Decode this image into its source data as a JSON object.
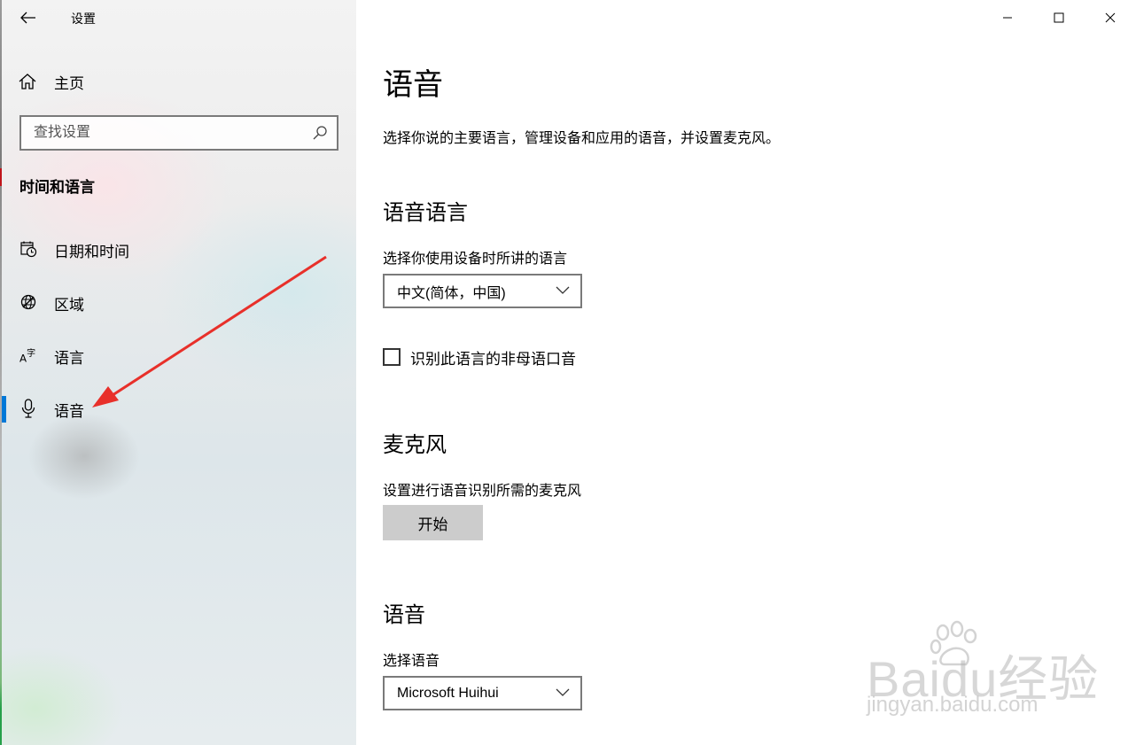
{
  "window": {
    "title": "设置",
    "controls": [
      "minimize",
      "maximize",
      "close"
    ]
  },
  "sidebar": {
    "home_label": "主页",
    "search_placeholder": "查找设置",
    "section_header": "时间和语言",
    "items": [
      {
        "label": "日期和时间",
        "icon": "calendar-clock-icon",
        "active": false
      },
      {
        "label": "区域",
        "icon": "globe-icon",
        "active": false
      },
      {
        "label": "语言",
        "icon": "language-icon",
        "active": false
      },
      {
        "label": "语音",
        "icon": "microphone-icon",
        "active": true
      }
    ]
  },
  "main": {
    "title": "语音",
    "description": "选择你说的主要语言，管理设备和应用的语音，并设置麦克风。",
    "speech_language": {
      "heading": "语音语言",
      "label": "选择你使用设备时所讲的语言",
      "selected": "中文(简体，中国)",
      "checkbox_label": "识别此语言的非母语口音",
      "checkbox_checked": false
    },
    "microphone": {
      "heading": "麦克风",
      "label": "设置进行语音识别所需的麦克风",
      "button": "开始"
    },
    "voices": {
      "heading": "语音",
      "label": "选择语音",
      "selected": "Microsoft Huihui"
    }
  },
  "watermark": {
    "brand": "Bai",
    "brand_suffix": "du",
    "brand_cn": "经验",
    "url": "jingyan.baidu.com"
  },
  "colors": {
    "accent": "#0078d7",
    "annotation_arrow": "#e8302a",
    "button_bg": "#cccccc"
  }
}
